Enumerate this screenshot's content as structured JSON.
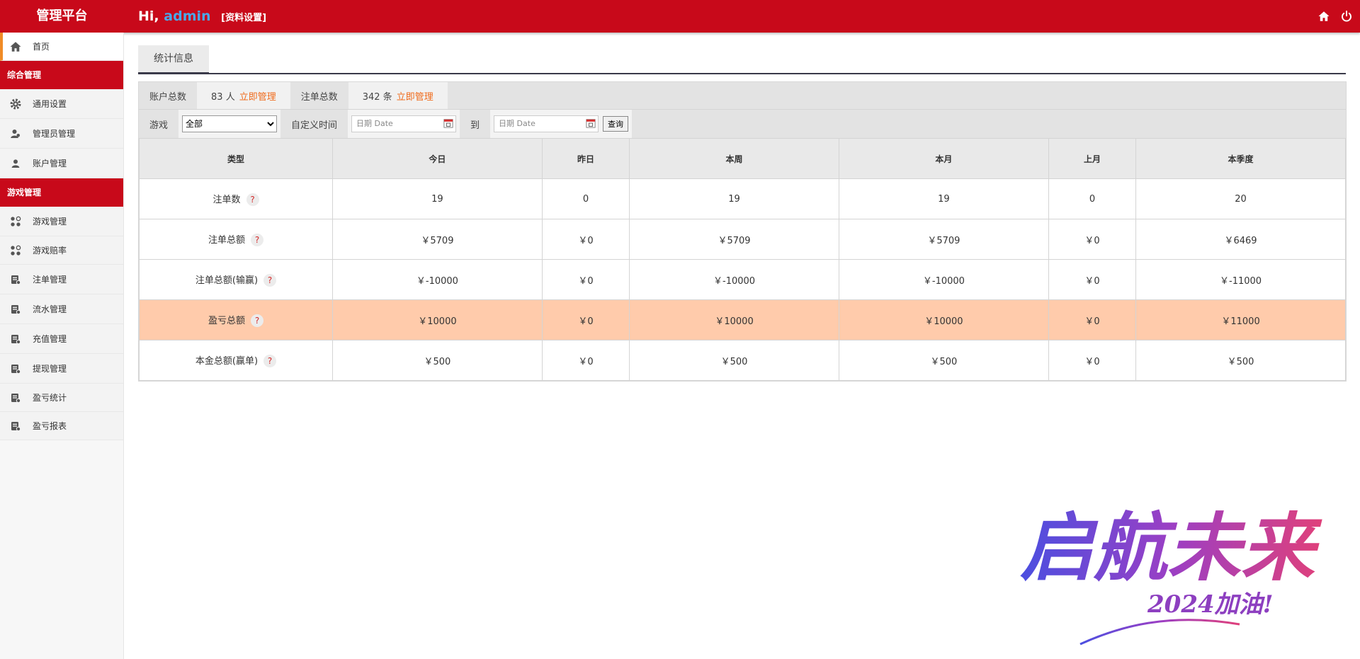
{
  "header": {
    "brand": "管理平台",
    "greeting": "Hi,",
    "username": "admin",
    "profile_link": "[资料设置]",
    "icons": [
      "home-icon",
      "power-icon"
    ]
  },
  "sidebar": {
    "home": "首页",
    "group1": "综合管理",
    "group1_items": [
      "通用设置",
      "管理员管理",
      "账户管理"
    ],
    "group2": "游戏管理",
    "group2_items": [
      "游戏管理",
      "游戏赔率",
      "注单管理",
      "流水管理",
      "充值管理",
      "提现管理",
      "盈亏统计",
      "盈亏报表"
    ]
  },
  "tab": "统计信息",
  "summary": {
    "accounts_label": "账户总数",
    "accounts_value": "83 人",
    "orders_label": "注单总数",
    "orders_value": "342 条",
    "manage_link": "立即管理"
  },
  "filter": {
    "game_label": "游戏",
    "game_selected": "全部",
    "custom_time_label": "自定义时间",
    "date_placeholder": "日期 Date",
    "to_label": "到",
    "query_button": "查询"
  },
  "table": {
    "headers": [
      "类型",
      "今日",
      "昨日",
      "本周",
      "本月",
      "上月",
      "本季度"
    ],
    "rows": [
      {
        "type": "注单数",
        "values": [
          "19",
          "0",
          "19",
          "19",
          "0",
          "20"
        ],
        "highlight": false
      },
      {
        "type": "注单总额",
        "values": [
          "￥5709",
          "￥0",
          "￥5709",
          "￥5709",
          "￥0",
          "￥6469"
        ],
        "highlight": false
      },
      {
        "type": "注单总额(输赢)",
        "values": [
          "￥-10000",
          "￥0",
          "￥-10000",
          "￥-10000",
          "￥0",
          "￥-11000"
        ],
        "highlight": false
      },
      {
        "type": "盈亏总额",
        "values": [
          "￥10000",
          "￥0",
          "￥10000",
          "￥10000",
          "￥0",
          "￥11000"
        ],
        "highlight": true
      },
      {
        "type": "本金总额(赢单)",
        "values": [
          "￥500",
          "￥0",
          "￥500",
          "￥500",
          "￥0",
          "￥500"
        ],
        "highlight": false
      }
    ],
    "help_mark": "?"
  },
  "watermark": {
    "main": "启航未来",
    "sub": "2024加油!"
  },
  "colors": {
    "brand_red": "#c8091a",
    "link_orange": "#f06a1a",
    "highlight_row": "#ffcbab",
    "username_blue": "#4aa8e8"
  }
}
